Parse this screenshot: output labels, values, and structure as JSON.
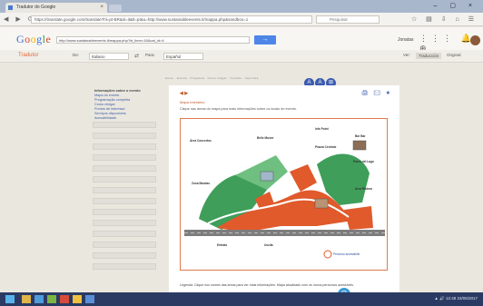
{
  "browser": {
    "tab_title": "Tradutor do Google",
    "tab_close": "×",
    "window_controls": "– ▢ ×",
    "nav_buttons": "◀ ▶ ⟳",
    "address": "https://translate.google.com/translate?hl=pt-BR&sl=it&tl=pt&u=http://www.sustainableevents.it/mappa.php&sandbox=1",
    "search_placeholder": "Pesquisar",
    "bar_icons": "☆ ▤ ⇩ ⌂ ☰"
  },
  "google_bar": {
    "logo_letters": [
      "G",
      "o",
      "o",
      "g",
      "l",
      "e"
    ],
    "logo_colors": [
      "#3b6fd6",
      "#d9452b",
      "#f1b400",
      "#3b6fd6",
      "#2f9e4b",
      "#d9452b"
    ],
    "url_value": "http://www.sustainableevents.it/mappa.php?id_item=16&cat_id=4",
    "go_button": "→",
    "user_label": "Jonatas",
    "icons": "⋮⋮⋮  🔔  ⊕"
  },
  "translate_bar": {
    "label": "Tradutor",
    "from_label": "De:",
    "from_value": "Italiano",
    "arrow": "⇄",
    "to_label": "Para:",
    "to_value": "Español",
    "view_label": "Ver:",
    "view_translated": "Traducción",
    "view_original": "Original"
  },
  "sidebar": {
    "heading": "Informações sobre o evento",
    "links": [
      "Mapa do evento",
      "Programação completa",
      "Como chegar",
      "Pontos de interesse",
      "Serviços disponíveis",
      "Acessibilidade"
    ],
    "rows": 14
  },
  "page": {
    "top_nav": "Home · Evento · Programa · Como chegar · Contato · Imprensa",
    "accessibility_buttons": [
      "A",
      "A",
      "⊞"
    ],
    "breadcrumb": "◀ ▶",
    "tools": "🖨 ✉ ★",
    "title": "Mapa Interativo",
    "intro": "Clique nas áreas do mapa para mais informações sobre os locais do evento.",
    "footnote": "Legenda: Clique nos nomes das áreas para ver mais informações. Mapa atualizado com os novos percursos acessíveis.",
    "fab": "Q",
    "map_labels": [
      {
        "text": "Área Concertos"
      },
      {
        "text": "Zona Bandas"
      },
      {
        "text": "Belle Musée"
      },
      {
        "text": "Info Point"
      },
      {
        "text": "Piazza Centrale"
      },
      {
        "text": "Bar Bar"
      },
      {
        "text": "Parco del Lago"
      },
      {
        "text": "Area Ristoro"
      },
      {
        "text": "Entrata"
      },
      {
        "text": "Uscita"
      },
      {
        "text": "Percorso accessibile"
      }
    ],
    "legend": "Percorso accessibile"
  },
  "taskbar": {
    "tray_text": "▲ 🔊 12:48  23/05/2017",
    "apps": [
      "#e0b44a",
      "#4f9bdc",
      "#7cb342",
      "#d84b3a",
      "#f0c040",
      "#5a8fd8"
    ]
  },
  "colors": {
    "accent_orange": "#e05a2b",
    "map_green": "#3f9e5a",
    "road_gray": "#7d7d7d",
    "link_blue": "#3c5da8"
  }
}
